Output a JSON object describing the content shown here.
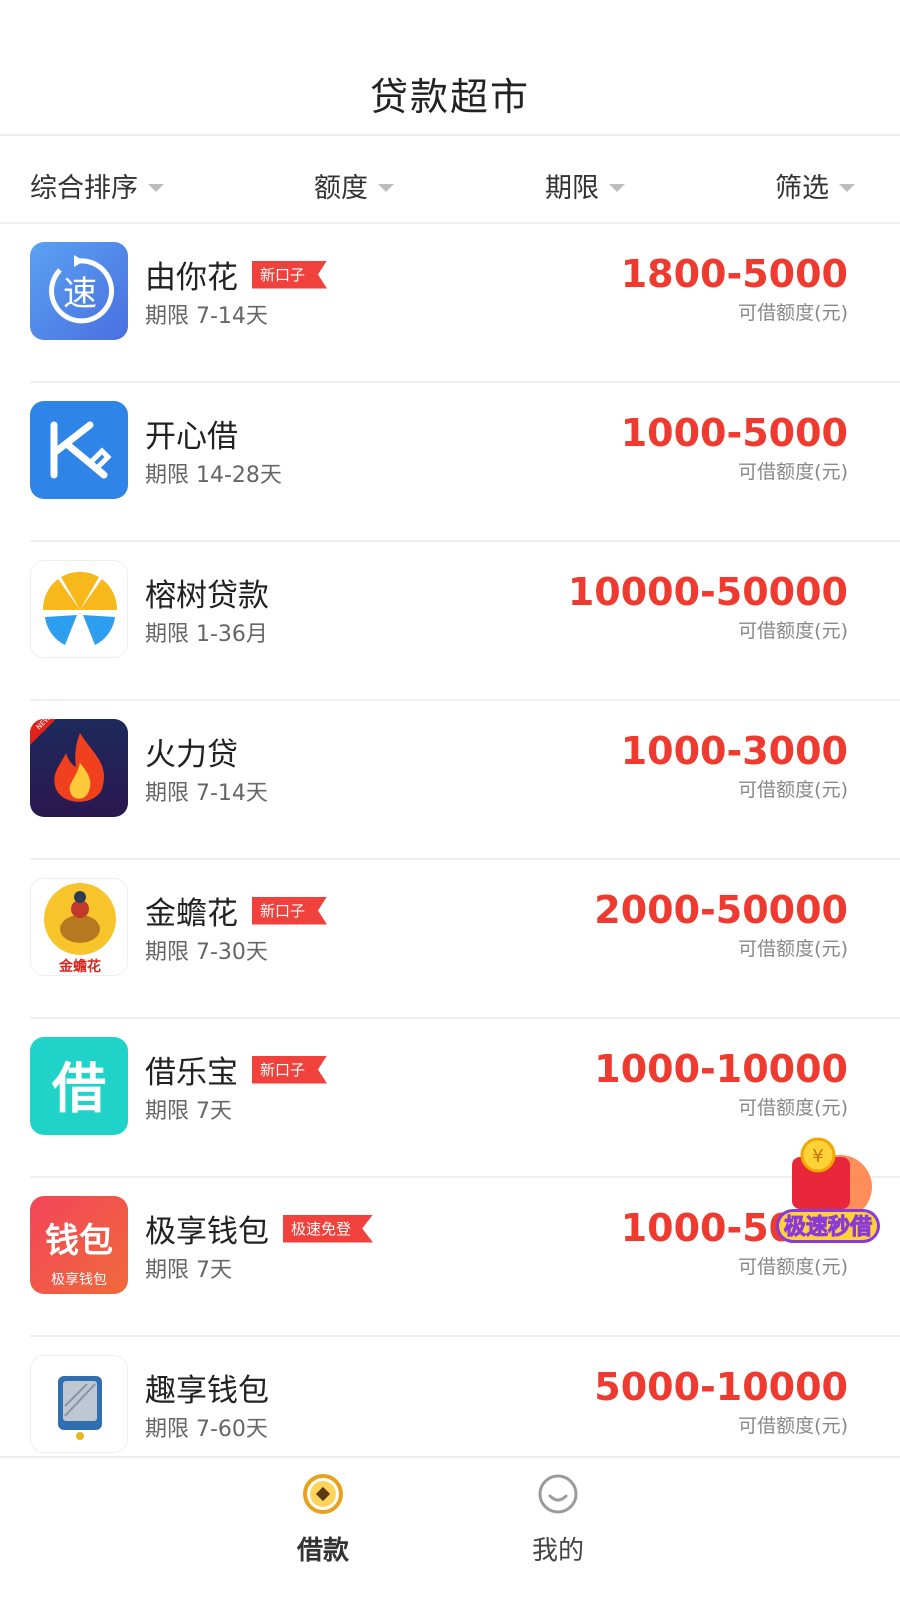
{
  "header": {
    "title": "贷款超市"
  },
  "filters": [
    {
      "label": "综合排序"
    },
    {
      "label": "额度"
    },
    {
      "label": "期限"
    },
    {
      "label": "筛选"
    }
  ],
  "products": [
    {
      "name": "由你花",
      "badge": "新口子",
      "term": "期限 7-14天",
      "amount": "1800-5000",
      "amount_label": "可借额度(元)",
      "logo_icon": "speed-icon",
      "logo_text": "速"
    },
    {
      "name": "开心借",
      "badge": "",
      "term": "期限 14-28天",
      "amount": "1000-5000",
      "amount_label": "可借额度(元)",
      "logo_icon": "k-logo-icon"
    },
    {
      "name": "榕树贷款",
      "badge": "",
      "term": "期限 1-36月",
      "amount": "10000-50000",
      "amount_label": "可借额度(元)",
      "logo_icon": "tree-logo-icon"
    },
    {
      "name": "火力贷",
      "badge": "",
      "term": "期限 7-14天",
      "amount": "1000-3000",
      "amount_label": "可借额度(元)",
      "logo_icon": "flame-icon",
      "logo_tag": "NEW"
    },
    {
      "name": "金蟾花",
      "badge": "新口子",
      "term": "期限 7-30天",
      "amount": "2000-50000",
      "amount_label": "可借额度(元)",
      "logo_icon": "golden-toad-icon",
      "logo_text": "金蟾花"
    },
    {
      "name": "借乐宝",
      "badge": "新口子",
      "term": "期限 7天",
      "amount": "1000-10000",
      "amount_label": "可借额度(元)",
      "logo_icon": "jie-logo-icon",
      "logo_text": "借"
    },
    {
      "name": "极享钱包",
      "badge": "极速免登",
      "term": "期限 7天",
      "amount": "1000-5000",
      "amount_label": "可借额度(元)",
      "logo_icon": "wallet-logo-icon",
      "logo_text": "钱包",
      "logo_subtext": "极享钱包"
    },
    {
      "name": "趣享钱包",
      "badge": "",
      "term": "期限 7-60天",
      "amount": "5000-10000",
      "amount_label": "可借额度(元)",
      "logo_icon": "card-logo-icon"
    }
  ],
  "promo": {
    "label": "极速秒借",
    "icon": "red-envelope-icon"
  },
  "tabbar": [
    {
      "label": "借款",
      "icon": "coin-icon",
      "active": true,
      "color": "#e8a11d"
    },
    {
      "label": "我的",
      "icon": "smile-icon",
      "active": false,
      "color": "#9a9a9a"
    }
  ],
  "colors": {
    "accent": "#ef3a30",
    "badge": "#f0413c"
  }
}
